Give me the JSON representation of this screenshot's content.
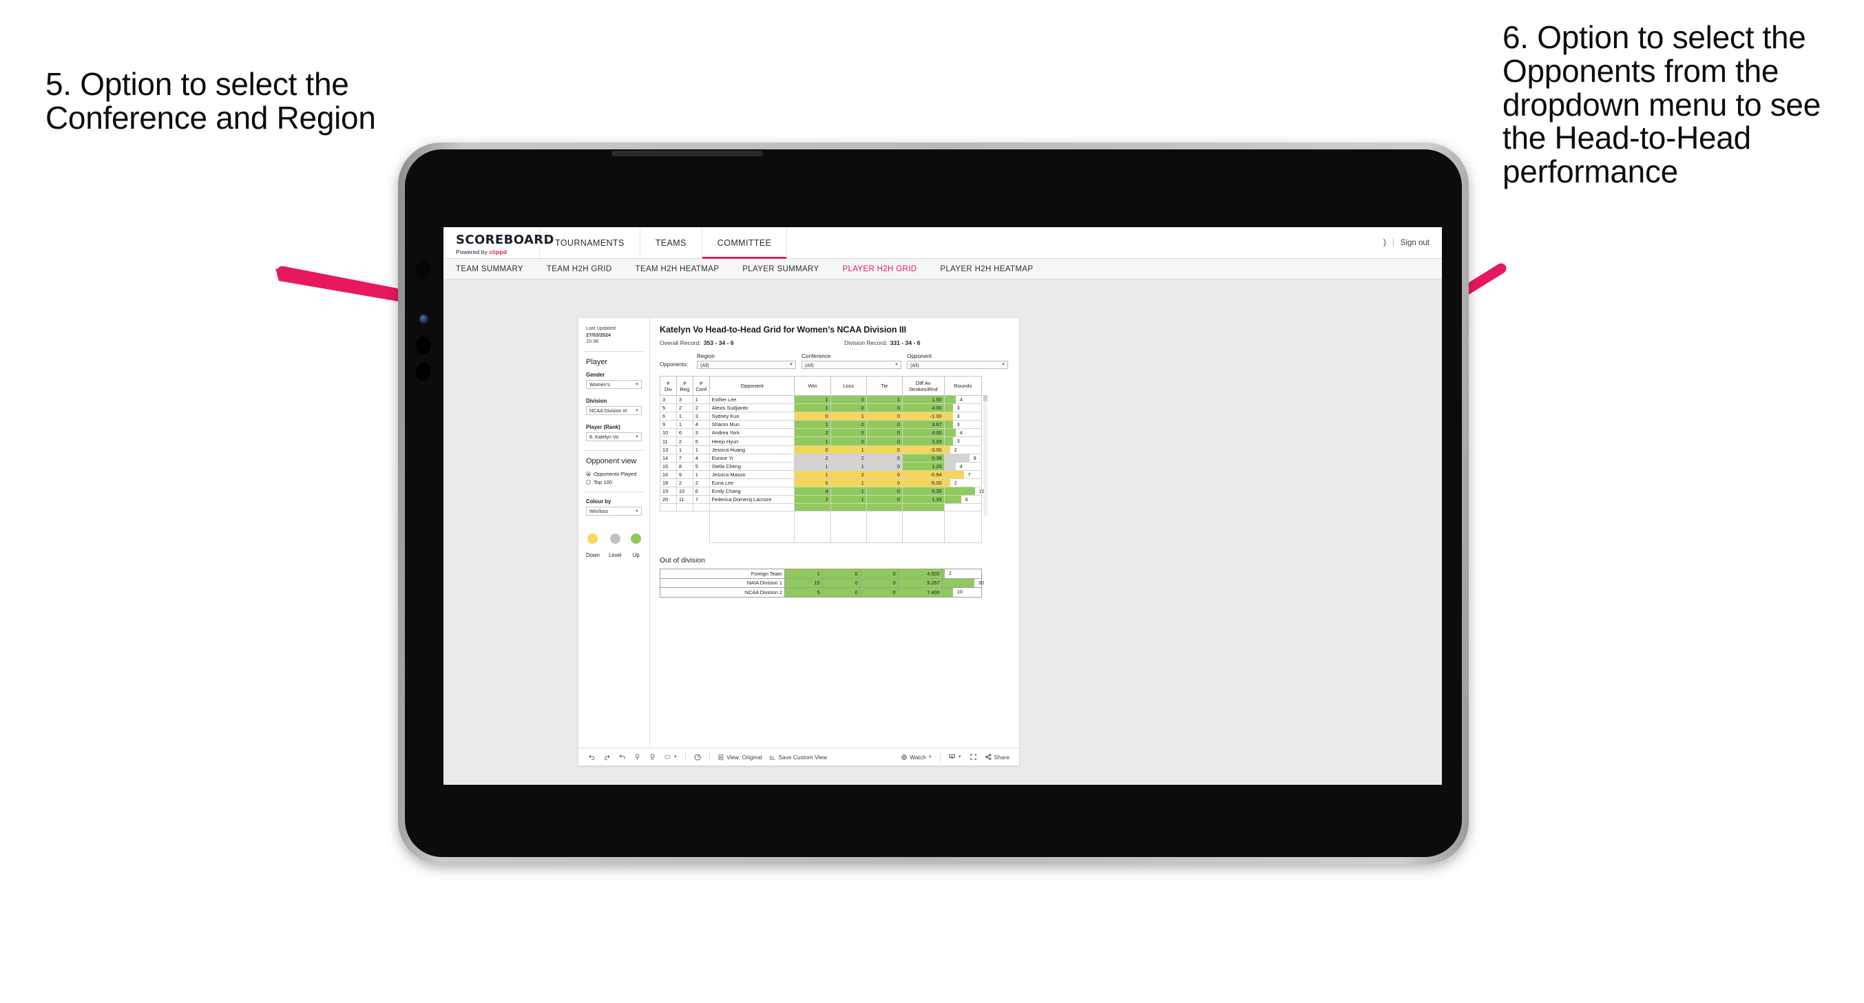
{
  "annotations": {
    "left": "5. Option to select the Conference and Region",
    "right": "6. Option to select the Opponents from the dropdown menu to see the Head-to-Head performance",
    "arrow_color": "#e8185f"
  },
  "app": {
    "logo": {
      "word": "SCOREBOARD",
      "powered_by": "Powered by",
      "brand": "clippd"
    },
    "topnav": [
      {
        "label": "TOURNAMENTS",
        "active": false
      },
      {
        "label": "TEAMS",
        "active": false
      },
      {
        "label": "COMMITTEE",
        "active": true
      }
    ],
    "topbar_right": {
      "user": ")",
      "separator": "|",
      "sign_out": "Sign out"
    },
    "subnav": [
      {
        "label": "TEAM SUMMARY",
        "active": false
      },
      {
        "label": "TEAM H2H GRID",
        "active": false
      },
      {
        "label": "TEAM H2H HEATMAP",
        "active": false
      },
      {
        "label": "PLAYER SUMMARY",
        "active": false
      },
      {
        "label": "PLAYER H2H GRID",
        "active": true
      },
      {
        "label": "PLAYER H2H HEATMAP",
        "active": false
      }
    ],
    "accent_color": "#e8174a"
  },
  "sidebar": {
    "last_updated_label": "Last Updated:",
    "last_updated_date": "27/03/2024",
    "last_updated_time": "15:38",
    "player_heading": "Player",
    "gender": {
      "label": "Gender",
      "value": "Women’s"
    },
    "division": {
      "label": "Division",
      "value": "NCAA Division III"
    },
    "player_rank": {
      "label": "Player (Rank)",
      "value": "8. Katelyn Vo"
    },
    "opponent_view": {
      "heading": "Opponent view",
      "options": [
        {
          "label": "Opponents Played",
          "selected": true
        },
        {
          "label": "Top 100",
          "selected": false
        }
      ]
    },
    "colour_by": {
      "label": "Colour by",
      "value": "Win/loss"
    },
    "legend": [
      {
        "caption": "Down",
        "color": "#f5d659"
      },
      {
        "caption": "Level",
        "color": "#bfc3c7"
      },
      {
        "caption": "Up",
        "color": "#90ca5c"
      }
    ]
  },
  "main": {
    "title": "Katelyn Vo Head-to-Head Grid for Women’s NCAA Division III",
    "overall_record_label": "Overall Record:",
    "overall_record_value": "353 - 34 - 6",
    "division_record_label": "Division Record:",
    "division_record_value": "331 - 34 - 6",
    "filters_prefix": "Opponents:",
    "filters": [
      {
        "label": "Region",
        "value": "(All)"
      },
      {
        "label": "Conference",
        "value": "(All)"
      },
      {
        "label": "Opponent",
        "value": "(All)"
      }
    ],
    "grid": {
      "headers": [
        "# Div",
        "# Reg",
        "# Conf",
        "Opponent",
        "Win",
        "Loss",
        "Tie",
        "Diff Av Strokes/Rnd",
        "Rounds"
      ],
      "header_lines": [
        [
          "#",
          "Div"
        ],
        [
          "#",
          "Reg"
        ],
        [
          "#",
          "Conf"
        ],
        [
          "Opponent"
        ],
        [
          "Win"
        ],
        [
          "Loss"
        ],
        [
          "Tie"
        ],
        [
          "Diff Av",
          "Strokes/Rnd"
        ],
        [
          "Rounds"
        ]
      ],
      "rounds_max": 11,
      "rows": [
        {
          "div": "3",
          "reg": "3",
          "conf": "1",
          "opponent": "Esther Lee",
          "win": "1",
          "loss": "0",
          "tie": "1",
          "diff": "1.50",
          "rounds": 4,
          "state": "up",
          "diff_state": "up"
        },
        {
          "div": "5",
          "reg": "2",
          "conf": "2",
          "opponent": "Alexis Sudjianto",
          "win": "1",
          "loss": "0",
          "tie": "0",
          "diff": "4.00",
          "rounds": 3,
          "state": "up",
          "diff_state": "up"
        },
        {
          "div": "6",
          "reg": "1",
          "conf": "3",
          "opponent": "Sydney Kuo",
          "win": "0",
          "loss": "1",
          "tie": "0",
          "diff": "-1.00",
          "rounds": 3,
          "state": "down",
          "diff_state": "down"
        },
        {
          "div": "9",
          "reg": "1",
          "conf": "4",
          "opponent": "Sharon Mun",
          "win": "1",
          "loss": "0",
          "tie": "0",
          "diff": "3.67",
          "rounds": 3,
          "state": "up",
          "diff_state": "up"
        },
        {
          "div": "10",
          "reg": "6",
          "conf": "3",
          "opponent": "Andrea York",
          "win": "2",
          "loss": "0",
          "tie": "0",
          "diff": "4.00",
          "rounds": 4,
          "state": "up",
          "diff_state": "up"
        },
        {
          "div": "11",
          "reg": "2",
          "conf": "5",
          "opponent": "Heejo Hyun",
          "win": "1",
          "loss": "0",
          "tie": "0",
          "diff": "3.33",
          "rounds": 3,
          "state": "up",
          "diff_state": "up"
        },
        {
          "div": "13",
          "reg": "1",
          "conf": "1",
          "opponent": "Jessica Huang",
          "win": "0",
          "loss": "1",
          "tie": "0",
          "diff": "-3.00",
          "rounds": 2,
          "state": "down",
          "diff_state": "down"
        },
        {
          "div": "14",
          "reg": "7",
          "conf": "4",
          "opponent": "Eunice Yi",
          "win": "2",
          "loss": "2",
          "tie": "0",
          "diff": "0.38",
          "rounds": 9,
          "state": "level",
          "diff_state": "up"
        },
        {
          "div": "15",
          "reg": "8",
          "conf": "5",
          "opponent": "Stella Cheng",
          "win": "1",
          "loss": "1",
          "tie": "0",
          "diff": "1.25",
          "rounds": 4,
          "state": "level",
          "diff_state": "up"
        },
        {
          "div": "16",
          "reg": "9",
          "conf": "1",
          "opponent": "Jessica Mason",
          "win": "1",
          "loss": "2",
          "tie": "0",
          "diff": "-0.94",
          "rounds": 7,
          "state": "down",
          "diff_state": "down"
        },
        {
          "div": "18",
          "reg": "2",
          "conf": "2",
          "opponent": "Euna Lee",
          "win": "0",
          "loss": "1",
          "tie": "0",
          "diff": "-5.00",
          "rounds": 2,
          "state": "down",
          "diff_state": "down"
        },
        {
          "div": "19",
          "reg": "10",
          "conf": "6",
          "opponent": "Emily Chang",
          "win": "4",
          "loss": "1",
          "tie": "0",
          "diff": "0.30",
          "rounds": 11,
          "state": "up",
          "diff_state": "up"
        },
        {
          "div": "20",
          "reg": "11",
          "conf": "7",
          "opponent": "Federica Domecq Lacroze",
          "win": "2",
          "loss": "1",
          "tie": "0",
          "diff": "1.33",
          "rounds": 6,
          "state": "up",
          "diff_state": "up"
        }
      ]
    },
    "out_of_division": {
      "title": "Out of division",
      "rounds_max": 30,
      "rows": [
        {
          "name": "Foreign Team",
          "win": "1",
          "loss": "0",
          "tie": "0",
          "diff": "4.500",
          "rounds": 2,
          "state": "up"
        },
        {
          "name": "NAIA Division 1",
          "win": "15",
          "loss": "0",
          "tie": "0",
          "diff": "9.267",
          "rounds": 30,
          "state": "up"
        },
        {
          "name": "NCAA Division 2",
          "win": "5",
          "loss": "0",
          "tie": "0",
          "diff": "7.400",
          "rounds": 10,
          "state": "up"
        }
      ]
    }
  },
  "toolbar": {
    "view_label": "View: Original",
    "save_label": "Save Custom View",
    "watch_label": "Watch",
    "share_label": "Share"
  },
  "colors": {
    "up": "#90ca5c",
    "down": "#f5d659",
    "level": "#d3d3d3",
    "accent": "#e8174a",
    "annotation_arrow": "#e8185f"
  }
}
